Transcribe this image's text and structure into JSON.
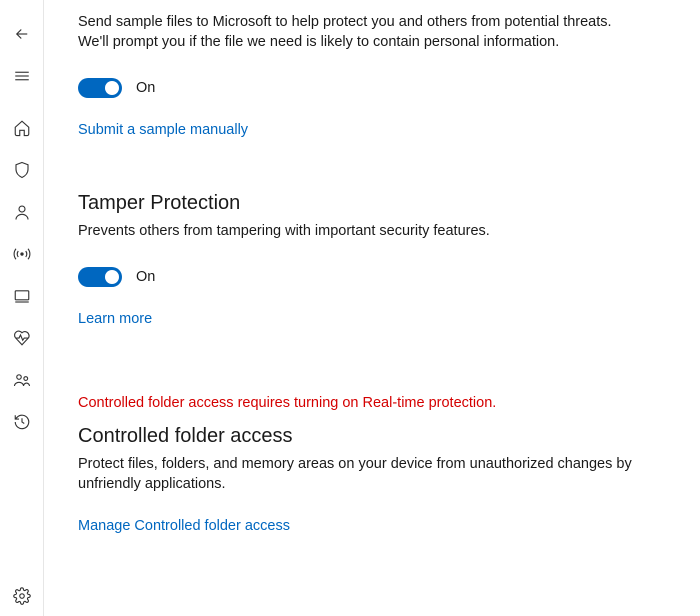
{
  "sample_submission": {
    "description": "Send sample files to Microsoft to help protect you and others from potential threats. We'll prompt you if the file we need is likely to contain personal information.",
    "toggle_state": "On",
    "link": "Submit a sample manually"
  },
  "tamper_protection": {
    "heading": "Tamper Protection",
    "description": "Prevents others from tampering with important security features.",
    "toggle_state": "On",
    "link": "Learn more"
  },
  "controlled_folder": {
    "warning": "Controlled folder access requires turning on Real-time protection.",
    "heading": "Controlled folder access",
    "description": "Protect files, folders, and memory areas on your device from unauthorized changes by unfriendly applications.",
    "link": "Manage Controlled folder access"
  }
}
